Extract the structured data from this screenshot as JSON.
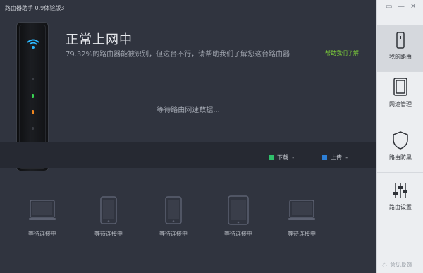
{
  "window": {
    "title": "路由器助手 0.9体验版3"
  },
  "status": {
    "heading": "正常上网中",
    "subtext": "79.32%的路由器能被识别，但这台不行，请帮助我们了解您这台路由器",
    "help_link": "帮助我们了解"
  },
  "speed": {
    "waiting_text": "等待路由网速数据...",
    "download_label": "下载: -",
    "upload_label": "上传: -",
    "download_color": "#2fbf6a",
    "upload_color": "#2d7fd6"
  },
  "devices": [
    {
      "icon": "laptop-icon",
      "label": "等待连接中"
    },
    {
      "icon": "phone-icon",
      "label": "等待连接中"
    },
    {
      "icon": "phone-icon",
      "label": "等待连接中"
    },
    {
      "icon": "tablet-icon",
      "label": "等待连接中"
    },
    {
      "icon": "laptop-icon",
      "label": "等待连接中"
    }
  ],
  "sidebar": {
    "items": [
      {
        "icon": "router-icon",
        "label": "我的路由",
        "active": true
      },
      {
        "icon": "speed-manage-icon",
        "label": "网速管理",
        "active": false
      },
      {
        "icon": "shield-icon",
        "label": "路由防黑",
        "active": false
      },
      {
        "icon": "sliders-icon",
        "label": "路由设置",
        "active": false
      }
    ],
    "feedback": "意见反馈"
  },
  "colors": {
    "accent_green": "#7fd43a",
    "led_green": "#39d353",
    "led_orange": "#f0861f",
    "wifi": "#2bb8ff"
  }
}
